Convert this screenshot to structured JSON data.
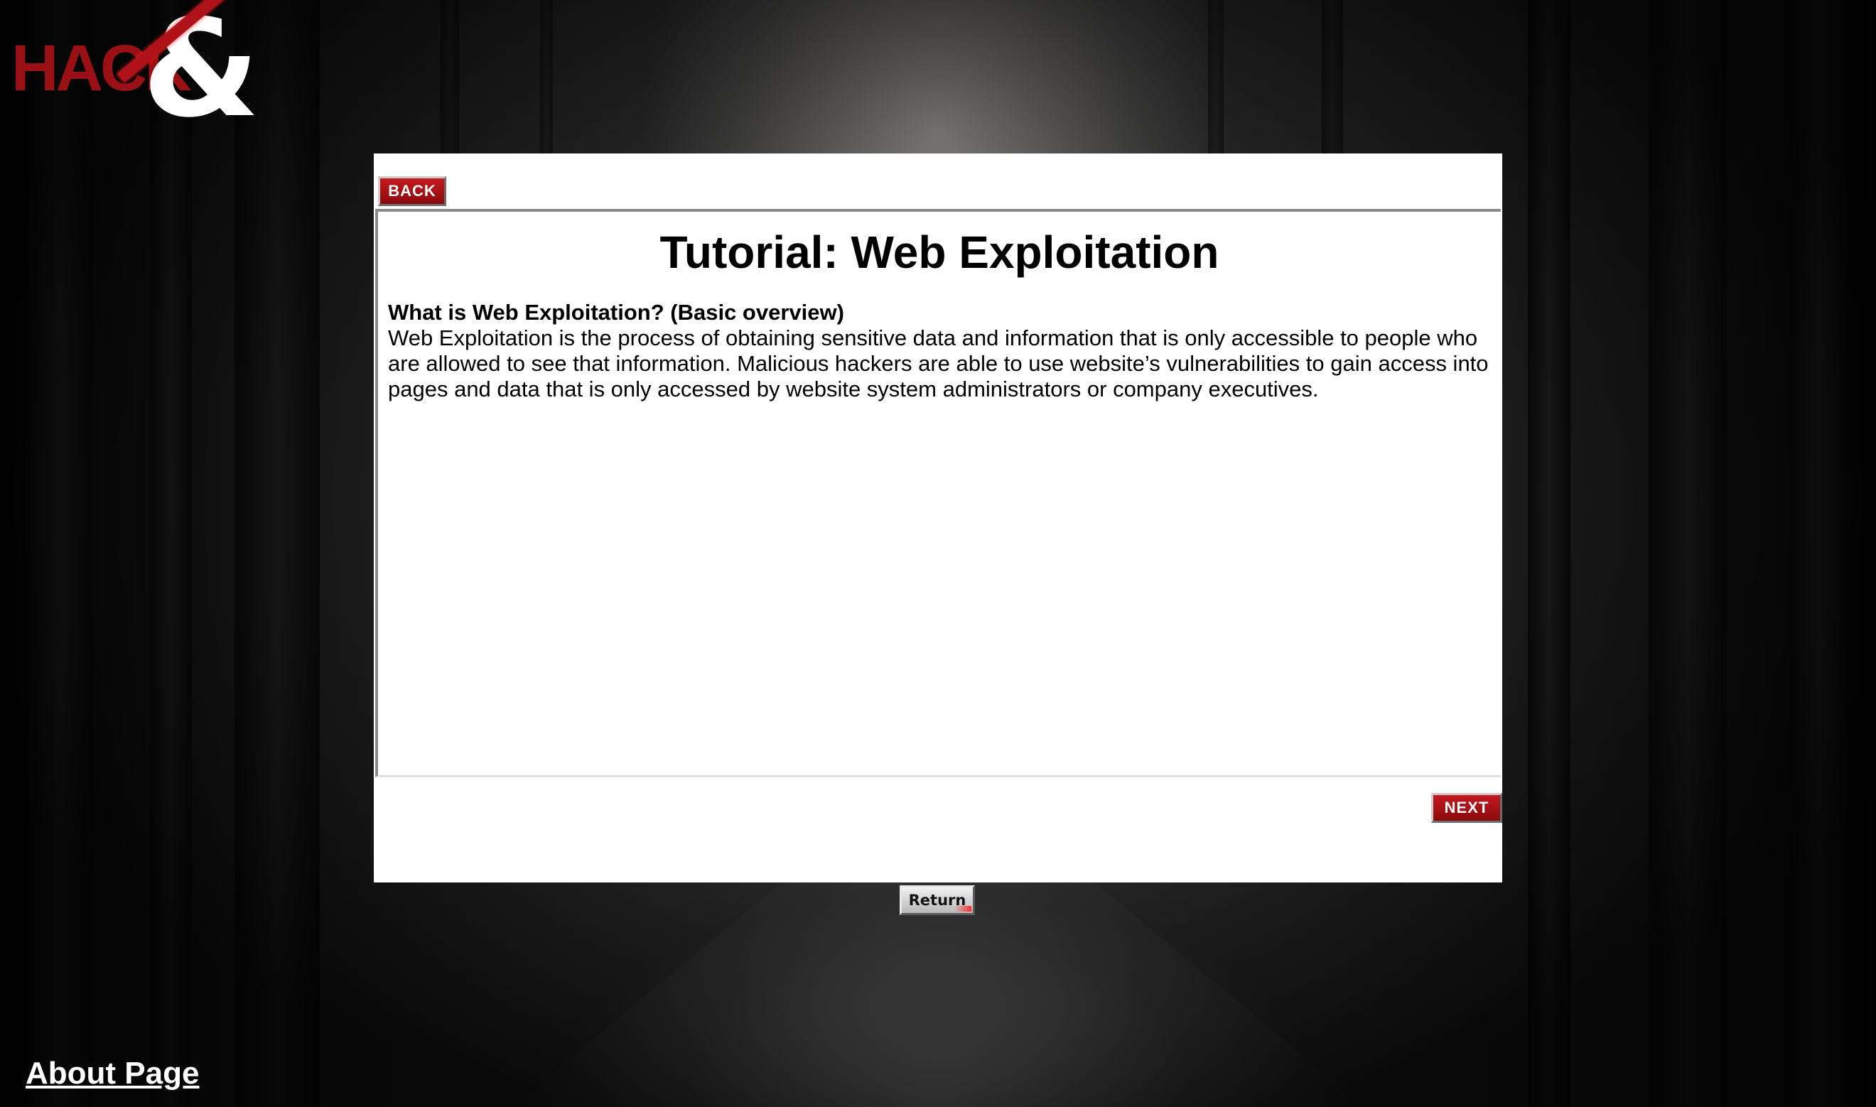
{
  "logo": {
    "word": "HACK",
    "symbol": "&"
  },
  "navigation": {
    "back_label": "BACK",
    "next_label": "NEXT",
    "return_label": "Return"
  },
  "tutorial": {
    "title": "Tutorial: Web Exploitation",
    "section_heading": "What is Web Exploitation? (Basic overview)",
    "section_body": "Web Exploitation is the process of obtaining sensitive data and information that is only accessible to people who are allowed to see that information. Malicious hackers are able to use website’s vulnerabilities to gain access into pages and data that is only accessed by website system administrators or company executives."
  },
  "footer": {
    "about_label": "About Page"
  },
  "colors": {
    "accent_red": "#9a1015",
    "panel_bg": "#ffffff"
  }
}
